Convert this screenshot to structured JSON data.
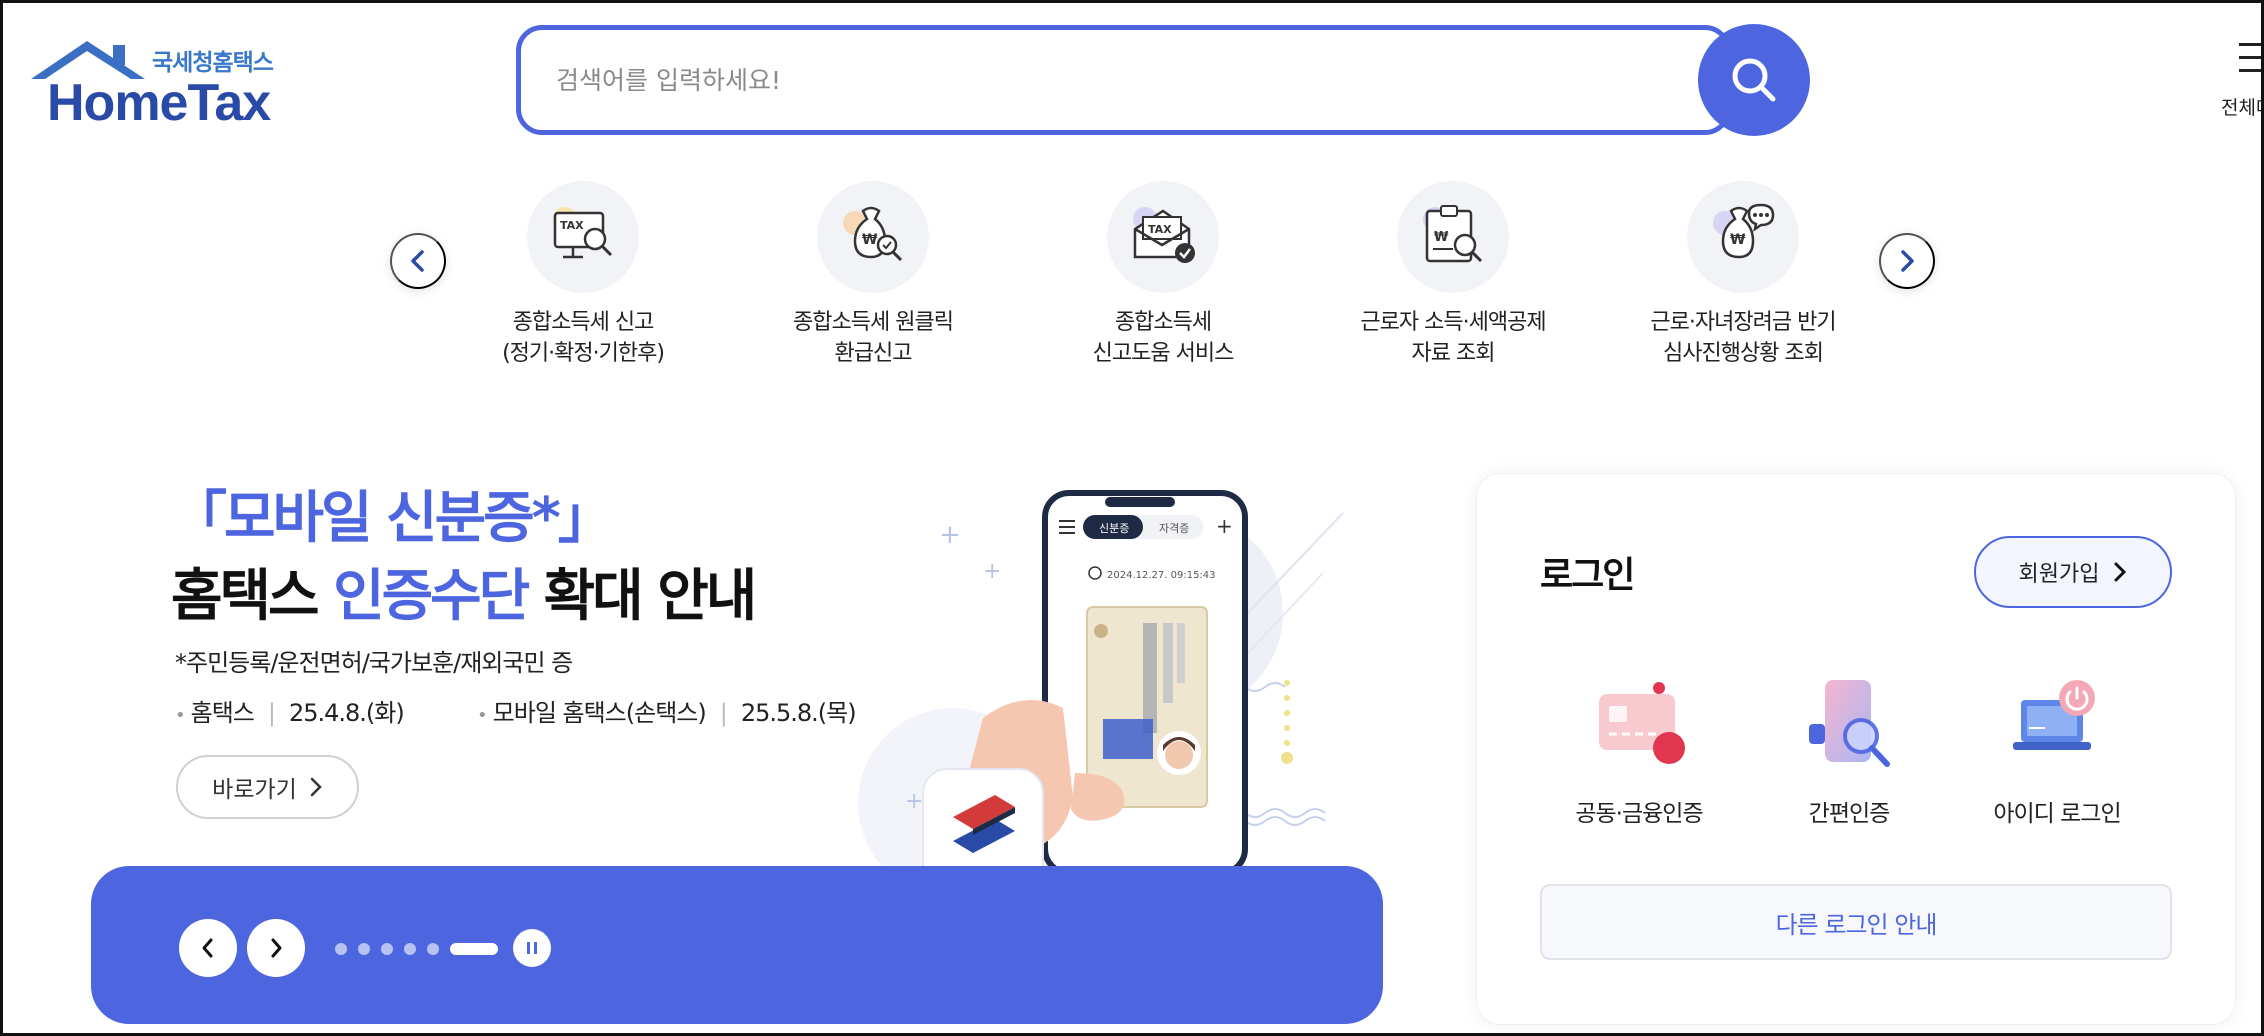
{
  "header": {
    "logo_sub": "국세청홈택스",
    "logo_main": "HomeTax",
    "search_placeholder": "검색어를 입력하세요!",
    "menu_label": "전체메"
  },
  "quick_menu": {
    "items": [
      {
        "line1": "종합소득세 신고",
        "line2": "(정기·확정·기한후)",
        "icon": "tax-monitor-search-icon"
      },
      {
        "line1": "종합소득세 원클릭",
        "line2": "환급신고",
        "icon": "money-bag-check-icon"
      },
      {
        "line1": "종합소득세",
        "line2": "신고도움 서비스",
        "icon": "tax-envelope-check-icon"
      },
      {
        "line1": "근로자 소득·세액공제",
        "line2": "자료 조회",
        "icon": "clipboard-search-icon"
      },
      {
        "line1": "근로·자녀장려금 반기",
        "line2": "심사진행상황 조회",
        "icon": "money-bag-chat-icon"
      }
    ]
  },
  "banner": {
    "title_line1": "「모바일 신분증*」",
    "title_line2_pre": "홈택스 ",
    "title_line2_hl": "인증수단",
    "title_line2_post": " 확대 안내",
    "note": "*주민등록/운전면허/국가보훈/재외국민 증",
    "date1_label": "홈택스",
    "date1_value": "25.4.8.(화)",
    "date2_label": "모바일 홈택스(손택스)",
    "date2_value": "25.5.8.(목)",
    "goto_label": "바로가기",
    "phone_tab1": "신분증",
    "phone_tab2": "자격증",
    "phone_time": "2024.12.27. 09:15:43",
    "slide_count": 6,
    "active_slide": 6
  },
  "login": {
    "title": "로그인",
    "signup_label": "회원가입",
    "options": [
      {
        "label": "공동·금융인증",
        "icon": "certificate-card-icon"
      },
      {
        "label": "간편인증",
        "icon": "phone-search-icon"
      },
      {
        "label": "아이디 로그인",
        "icon": "laptop-power-icon"
      }
    ],
    "other_login_label": "다른 로그인 안내"
  },
  "colors": {
    "accent": "#4d66e0",
    "logo_dark": "#2a4aa8",
    "logo_light": "#3a79c9"
  }
}
